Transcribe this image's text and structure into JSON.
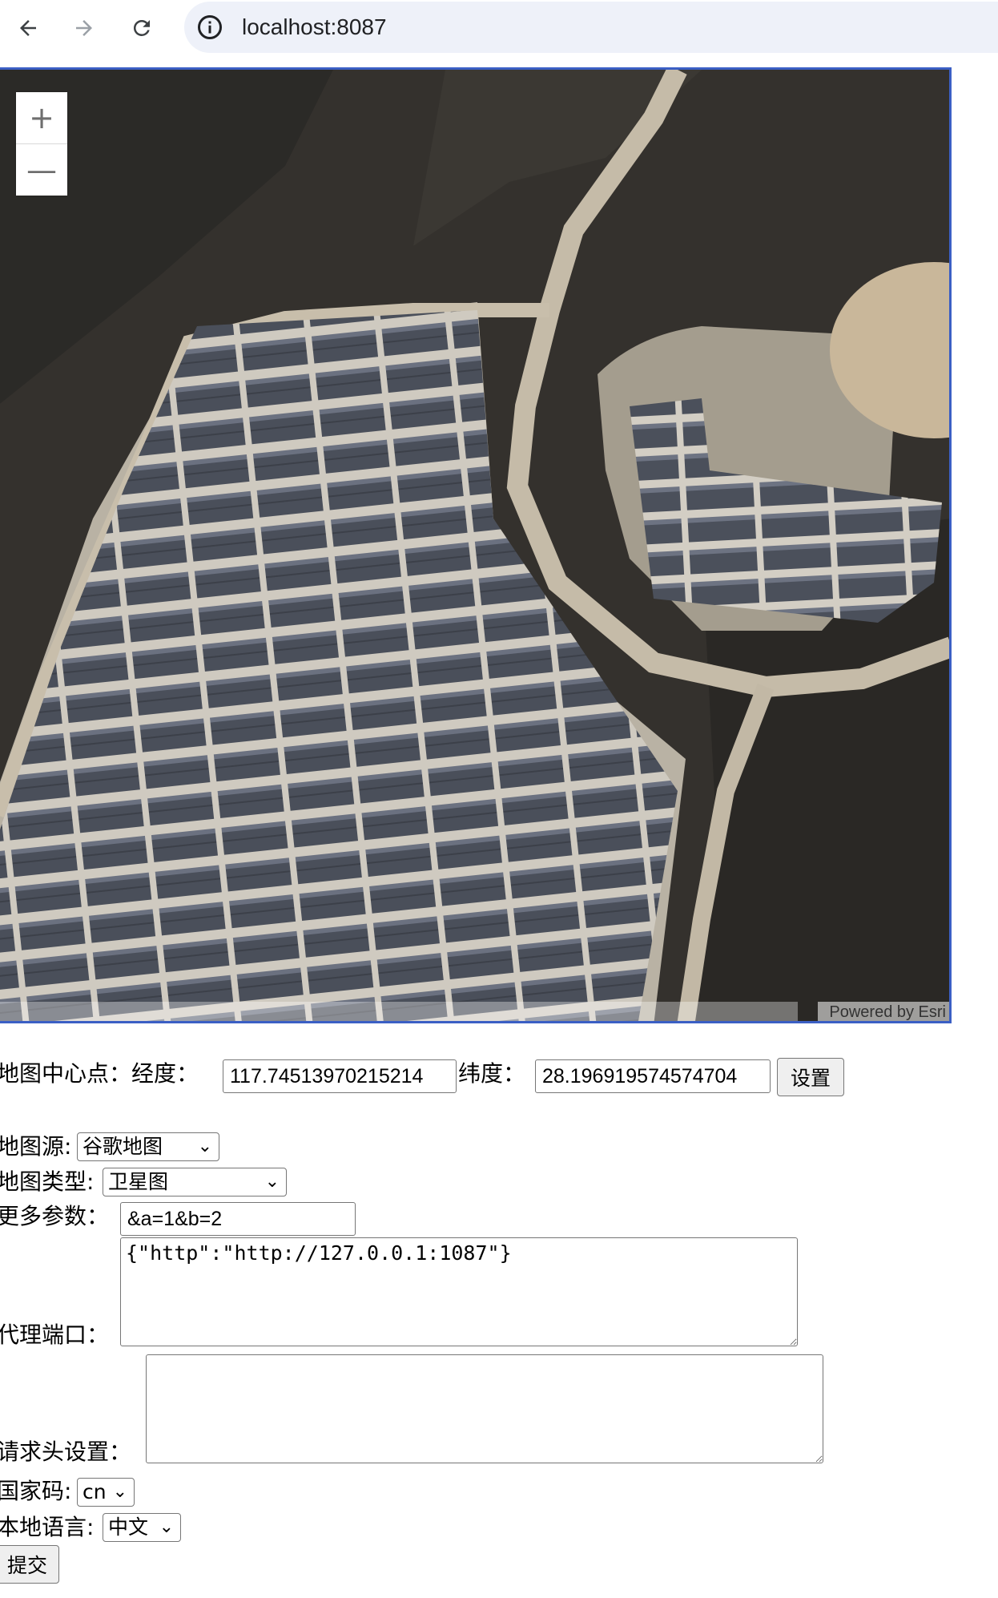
{
  "browser": {
    "url": "localhost:8087"
  },
  "map": {
    "attribution": "Powered by Esri",
    "zoom_in": "+",
    "zoom_out": "—"
  },
  "center": {
    "label": "地图中心点：经度：",
    "lng_value": "117.74513970215214",
    "lat_label": "纬度：",
    "lat_value": "28.196919574574704",
    "set_button": "设置"
  },
  "form": {
    "source_label": "地图源:",
    "source_value": "谷歌地图",
    "type_label": "地图类型:",
    "type_value": "卫星图",
    "params_label": "更多参数：",
    "params_value": "&a=1&b=2",
    "proxy_label": "代理端口：",
    "proxy_value": "{\"http\":\"http://127.0.0.1:1087\"}",
    "headers_label": "请求头设置：",
    "headers_value": "",
    "country_label": "国家码:",
    "country_value": "cn",
    "lang_label": "本地语言:",
    "lang_value": "中文",
    "submit": "提交"
  }
}
